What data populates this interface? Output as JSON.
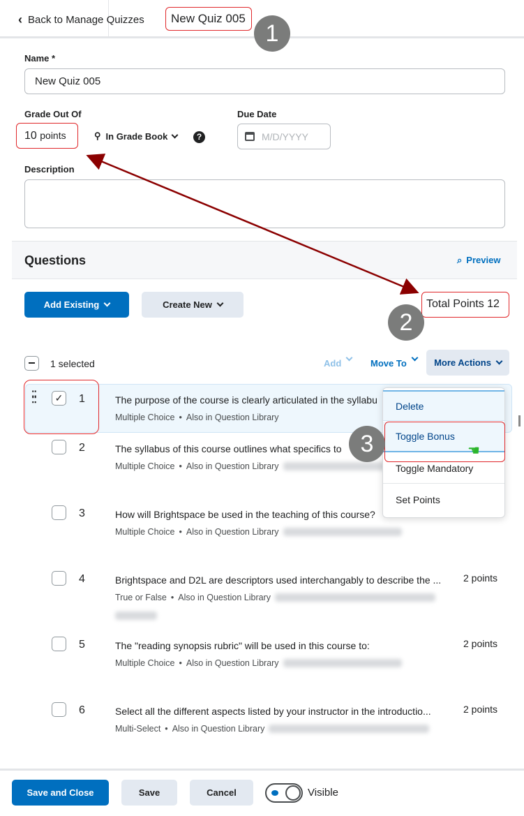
{
  "header": {
    "back_label": "Back to Manage Quizzes",
    "title": "New Quiz 005"
  },
  "form": {
    "name_label": "Name *",
    "name_value": "New Quiz 005",
    "grade_label": "Grade Out Of",
    "grade_value": "10",
    "grade_unit": "points",
    "grade_book": "In Grade Book",
    "due_label": "Due Date",
    "due_placeholder": "M/D/YYYY",
    "description_label": "Description",
    "description_value": ""
  },
  "questions": {
    "heading": "Questions",
    "preview": "Preview",
    "add_existing": "Add Existing",
    "create_new": "Create New",
    "total_points": "Total Points 12",
    "selected": "1 selected",
    "add": "Add",
    "move_to": "Move To",
    "more_actions": "More Actions",
    "items": [
      {
        "num": "1",
        "text": "The purpose of the course is clearly articulated in the syllabu",
        "type": "Multiple Choice",
        "library": "Also in Question Library",
        "points": "",
        "checked": true
      },
      {
        "num": "2",
        "text": "The syllabus of this course outlines what specifics to",
        "type": "Multiple Choice",
        "library": "Also in  Question Library",
        "points": "",
        "checked": false
      },
      {
        "num": "3",
        "text": "How will Brightspace be used in the teaching of this course?",
        "type": "Multiple Choice",
        "library": "Also in  Question Library",
        "points": "",
        "checked": false
      },
      {
        "num": "4",
        "text": "Brightspace and D2L are descriptors used interchangably to describe the ...",
        "type": "True or False",
        "library": "Also in Question Library",
        "points": "2 points",
        "checked": false
      },
      {
        "num": "5",
        "text": "The \"reading synopsis rubric\" will be used in this course to:",
        "type": "Multiple Choice",
        "library": "Also in  Question Library",
        "points": "2 points",
        "checked": false
      },
      {
        "num": "6",
        "text": "Select all the different aspects listed by your instructor in the introductio...",
        "type": "Multi-Select",
        "library": "Also in  Question Library",
        "points": "2 points",
        "checked": false
      }
    ]
  },
  "menu": {
    "items": [
      "Delete",
      "Toggle Bonus",
      "Toggle Mandatory",
      "Set Points"
    ]
  },
  "footer": {
    "save_close": "Save and Close",
    "save": "Save",
    "cancel": "Cancel",
    "visible": "Visible",
    "visible_on": true
  },
  "annotations": {
    "b1": "1",
    "b2": "2",
    "b3": "3"
  },
  "colors": {
    "primary": "#006fbf",
    "annotation": "#e0272a",
    "arrow": "#8b0000",
    "selected_row": "#eef7fd"
  }
}
